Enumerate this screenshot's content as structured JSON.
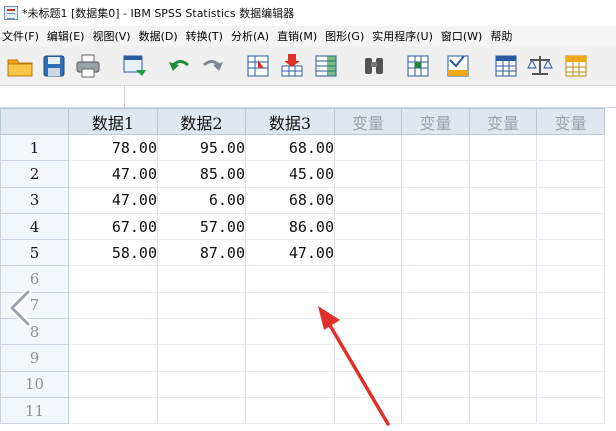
{
  "window": {
    "title": "*未标题1 [数据集0] - IBM SPSS Statistics 数据编辑器"
  },
  "menu": [
    "文件(F)",
    "编辑(E)",
    "视图(V)",
    "数据(D)",
    "转换(T)",
    "分析(A)",
    "直销(M)",
    "图形(G)",
    "实用程序(U)",
    "窗口(W)",
    "帮助"
  ],
  "toolbar": {
    "buttons": [
      "open-folder-icon",
      "save-icon",
      "print-icon",
      "dialog-recall-icon",
      "undo-icon",
      "redo-icon",
      "goto-case-icon",
      "goto-variable-icon",
      "variables-icon",
      "find-icon",
      "insert-cases-icon",
      "insert-variable-icon",
      "split-file-icon",
      "weight-cases-icon",
      "select-cases-icon"
    ]
  },
  "editor": {
    "cell_ref": "",
    "cell_value": ""
  },
  "grid": {
    "columns": [
      "数据1",
      "数据2",
      "数据3",
      "变量",
      "变量",
      "变量",
      "变量"
    ],
    "rows": [
      {
        "num": "1",
        "values": [
          "78.00",
          "95.00",
          "68.00"
        ]
      },
      {
        "num": "2",
        "values": [
          "47.00",
          "85.00",
          "45.00"
        ]
      },
      {
        "num": "3",
        "values": [
          "47.00",
          "6.00",
          "68.00"
        ]
      },
      {
        "num": "4",
        "values": [
          "67.00",
          "57.00",
          "86.00"
        ]
      },
      {
        "num": "5",
        "values": [
          "58.00",
          "87.00",
          "47.00"
        ]
      },
      {
        "num": "6",
        "values": [
          "",
          "",
          ""
        ]
      },
      {
        "num": "7",
        "values": [
          "",
          "",
          ""
        ]
      },
      {
        "num": "8",
        "values": [
          "",
          "",
          ""
        ]
      },
      {
        "num": "9",
        "values": [
          "",
          "",
          ""
        ]
      },
      {
        "num": "10",
        "values": [
          "",
          "",
          ""
        ]
      },
      {
        "num": "11",
        "values": [
          "",
          "",
          ""
        ]
      }
    ]
  },
  "colors": {
    "header_bg": "#dfe7f1",
    "arrow": "#e0302a"
  }
}
